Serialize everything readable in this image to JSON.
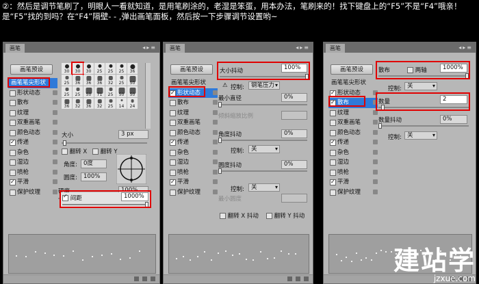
{
  "instruction": "②：然后是调节笔刷了，明眼人一看就知道，是用笔刷涂的，老湿是笨蛋，用本办法，笔刷来的！找下键盘上的“F5”不是“F4”哦亲！是“F5”找的到吗？在“F4”隔壁- - ,弹出画笔面板，然后按一下步骤调节设置哟~",
  "panel_tab": "画笔",
  "preset_button": "画笔预设",
  "panel1": {
    "list": [
      {
        "label": "画笔笔尖形状",
        "checkbox": false,
        "selected": true,
        "head": true
      },
      {
        "label": "形状动态",
        "checkbox": true,
        "checked": false
      },
      {
        "label": "散布",
        "checkbox": true,
        "checked": false
      },
      {
        "label": "纹理",
        "checkbox": true,
        "checked": false
      },
      {
        "label": "双重画笔",
        "checkbox": true,
        "checked": false
      },
      {
        "label": "颜色动态",
        "checkbox": true,
        "checked": false
      },
      {
        "label": "传递",
        "checkbox": true,
        "checked": true
      },
      {
        "label": "杂色",
        "checkbox": true,
        "checked": false
      },
      {
        "label": "湿边",
        "checkbox": true,
        "checked": false
      },
      {
        "label": "喷枪",
        "checkbox": true,
        "checked": false
      },
      {
        "label": "平滑",
        "checkbox": true,
        "checked": true
      },
      {
        "label": "保护纹理",
        "checkbox": true,
        "checked": false
      }
    ],
    "brush_sizes": [
      "30",
      "30",
      "30",
      "25",
      "25",
      "25",
      "36",
      "25",
      "36",
      "36",
      "36",
      "32",
      "25",
      "50",
      "25",
      "25",
      "50",
      "71",
      "25",
      "50",
      "50",
      "36",
      "32",
      "36",
      "32",
      "25",
      "14",
      "24"
    ],
    "size_label": "大小",
    "size_value": "3 px",
    "flip_x": "翻转 X",
    "flip_y": "翻转 Y",
    "angle_label": "角度:",
    "angle_value": "0度",
    "roundness_label": "圆度:",
    "roundness_value": "100%",
    "hardness_label": "硬度",
    "hardness_value": "100%",
    "spacing_label": "间距",
    "spacing_value": "1000%"
  },
  "panel2": {
    "list": [
      {
        "label": "画笔笔尖形状",
        "checkbox": false,
        "head": true
      },
      {
        "label": "形状动态",
        "checkbox": true,
        "checked": true,
        "selected": true
      },
      {
        "label": "散布",
        "checkbox": true,
        "checked": false
      },
      {
        "label": "纹理",
        "checkbox": true,
        "checked": false
      },
      {
        "label": "双重画笔",
        "checkbox": true,
        "checked": false
      },
      {
        "label": "颜色动态",
        "checkbox": true,
        "checked": false
      },
      {
        "label": "传递",
        "checkbox": true,
        "checked": true
      },
      {
        "label": "杂色",
        "checkbox": true,
        "checked": false
      },
      {
        "label": "湿边",
        "checkbox": true,
        "checked": false
      },
      {
        "label": "喷枪",
        "checkbox": true,
        "checked": false
      },
      {
        "label": "平滑",
        "checkbox": true,
        "checked": true
      },
      {
        "label": "保护纹理",
        "checkbox": true,
        "checked": false
      }
    ],
    "size_jitter_label": "大小抖动",
    "size_jitter_value": "100%",
    "control_label": "控制:",
    "control_value": "钢笔压力",
    "min_diameter_label": "最小直径",
    "min_diameter_value": "0%",
    "tilt_scale_label": "倾斜缩放比例",
    "angle_jitter_label": "角度抖动",
    "angle_jitter_value": "0%",
    "control2_value": "关",
    "roundness_jitter_label": "圆度抖动",
    "roundness_jitter_value": "0%",
    "control3_value": "关",
    "min_roundness_label": "最小圆度",
    "flip_x_jitter": "翻转 X 抖动",
    "flip_y_jitter": "翻转 Y 抖动"
  },
  "panel3": {
    "list": [
      {
        "label": "画笔笔尖形状",
        "checkbox": false,
        "head": true
      },
      {
        "label": "形状动态",
        "checkbox": true,
        "checked": true
      },
      {
        "label": "散布",
        "checkbox": true,
        "checked": true,
        "selected": true
      },
      {
        "label": "纹理",
        "checkbox": true,
        "checked": false
      },
      {
        "label": "双重画笔",
        "checkbox": true,
        "checked": false
      },
      {
        "label": "颜色动态",
        "checkbox": true,
        "checked": false
      },
      {
        "label": "传递",
        "checkbox": true,
        "checked": true
      },
      {
        "label": "杂色",
        "checkbox": true,
        "checked": false
      },
      {
        "label": "湿边",
        "checkbox": true,
        "checked": false
      },
      {
        "label": "喷枪",
        "checkbox": true,
        "checked": false
      },
      {
        "label": "平滑",
        "checkbox": true,
        "checked": true
      },
      {
        "label": "保护纹理",
        "checkbox": true,
        "checked": false
      }
    ],
    "scatter_label": "散布",
    "both_axes_label": "两轴",
    "scatter_value": "1000%",
    "control_label": "控制:",
    "control_value": "关",
    "count_label": "数量",
    "count_value": "2",
    "count_jitter_label": "数量抖动",
    "count_jitter_value": "0%",
    "control2_value": "关"
  },
  "watermark": {
    "big": "建站学",
    "small": "jzxue.com"
  },
  "colors": {
    "highlight": "#e00000",
    "selection": "#2f7ad9",
    "panel": "#b7b7b7"
  }
}
